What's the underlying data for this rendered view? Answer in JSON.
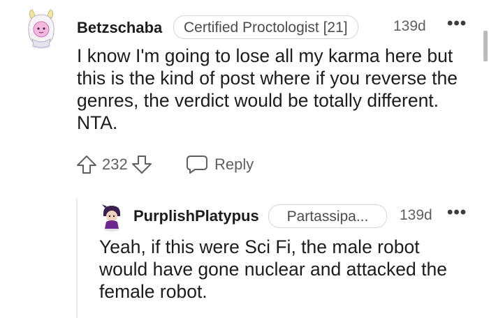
{
  "comment": {
    "username": "Betzschaba",
    "flair": "Certified Proctologist [21]",
    "age": "139d",
    "more_icon": "ellipsis-icon",
    "body_lines": [
      "I know I'm going to lose all my karma here but",
      "this is the kind of post where if you reverse the",
      "genres, the verdict would be totally different.",
      "NTA."
    ],
    "score": "232",
    "reply_label": "Reply"
  },
  "reply": {
    "username": "PurplishPlatypus",
    "flair": "Partassipa...",
    "age": "139d",
    "more_icon": "ellipsis-icon",
    "body_lines": [
      "Yeah, if this were Sci Fi, the male robot",
      "would have gone nuclear and attacked the",
      "female robot."
    ]
  },
  "colors": {
    "text": "#1c1c1c",
    "meta": "#5d5f62",
    "flair_border": "#d4d6d8",
    "thread_line": "#e8eaed",
    "avatar_purple": "#6b2a8c"
  }
}
